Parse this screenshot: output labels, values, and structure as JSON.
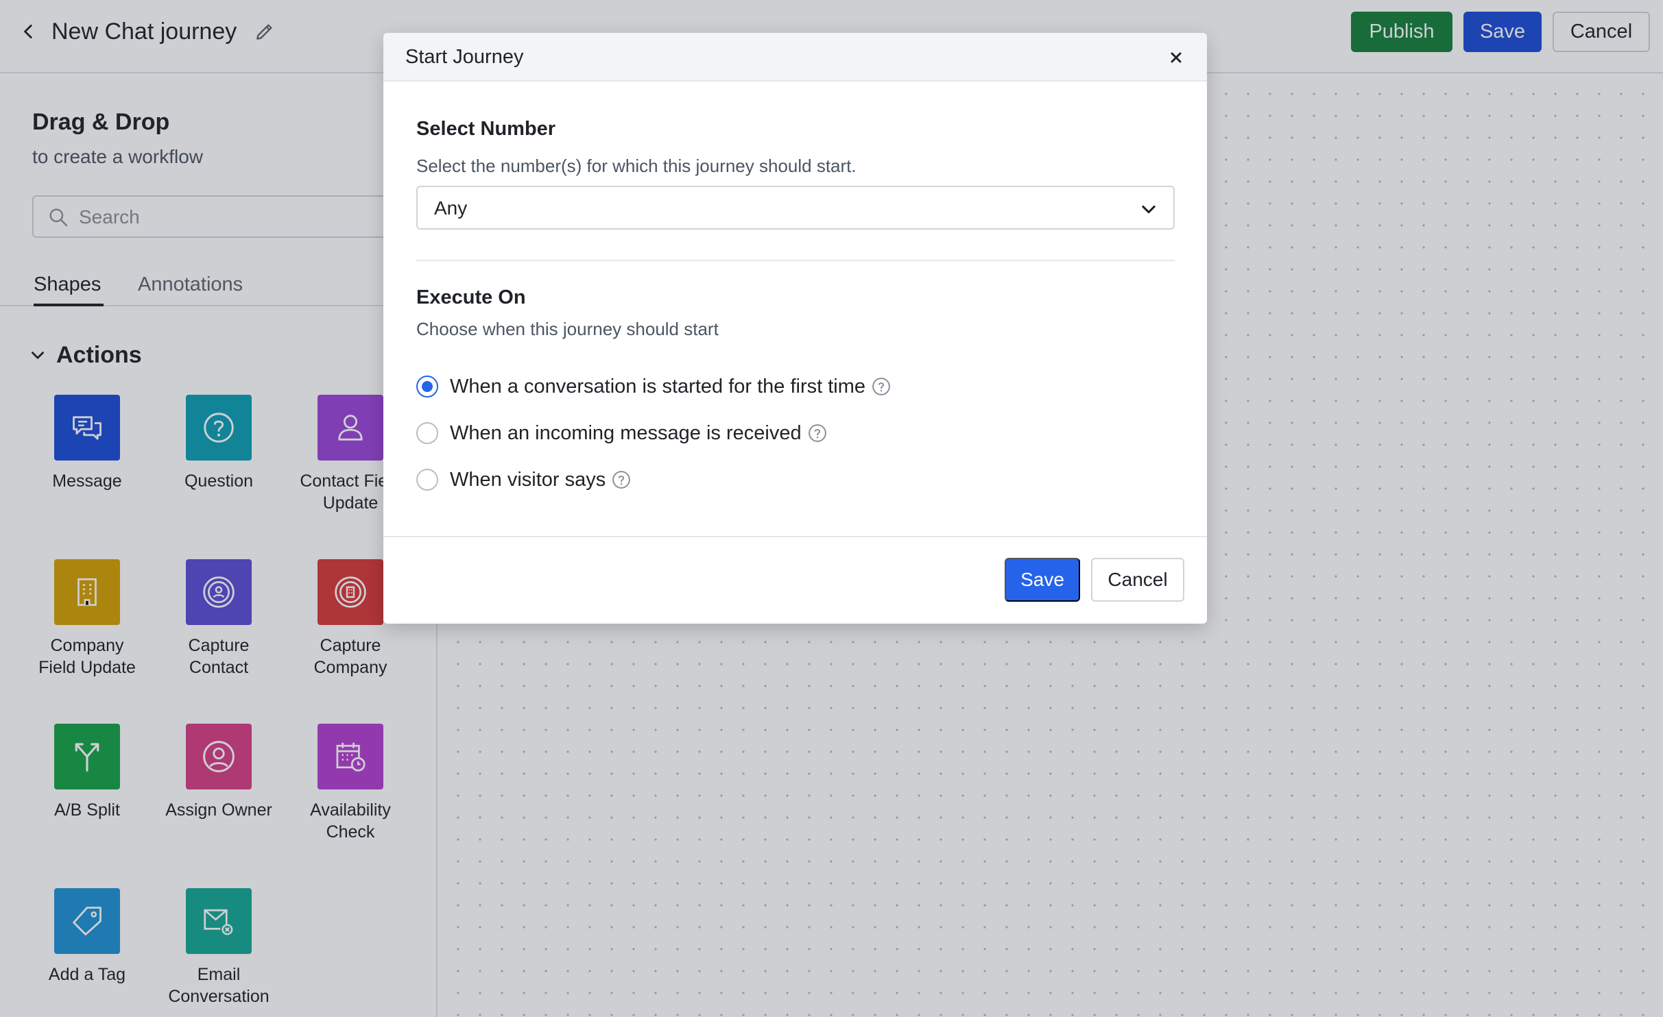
{
  "header": {
    "title": "New Chat journey",
    "publish_label": "Publish",
    "save_label": "Save",
    "cancel_label": "Cancel",
    "colors": {
      "publish": "#15803d",
      "save": "#1d4ed8"
    }
  },
  "sidebar": {
    "title": "Drag & Drop",
    "subtitle": "to create a workflow",
    "search_placeholder": "Search",
    "tabs": [
      {
        "label": "Shapes",
        "active": true
      },
      {
        "label": "Annotations",
        "active": false
      }
    ],
    "section_title": "Actions",
    "shapes": [
      {
        "label": "Message",
        "icon": "chat-bubbles-icon",
        "color": "#1d4ed8"
      },
      {
        "label": "Question",
        "icon": "question-circle-icon",
        "color": "#0e9fb5"
      },
      {
        "label": "Contact Field\nUpdate",
        "icon": "person-icon",
        "color": "#9b46d9"
      },
      {
        "label": "Company\nField Update",
        "icon": "building-icon",
        "color": "#d4a106"
      },
      {
        "label": "Capture\nContact",
        "icon": "capture-contact-icon",
        "color": "#5b4fd6"
      },
      {
        "label": "Capture\nCompany",
        "icon": "capture-company-icon",
        "color": "#d63a3a"
      },
      {
        "label": "A/B Split",
        "icon": "split-arrow-icon",
        "color": "#16a34a"
      },
      {
        "label": "Assign Owner",
        "icon": "owner-icon",
        "color": "#d63f86"
      },
      {
        "label": "Availability\nCheck",
        "icon": "calendar-clock-icon",
        "color": "#b43fd1"
      },
      {
        "label": "Add a Tag",
        "icon": "tag-icon",
        "color": "#1f93d6"
      },
      {
        "label": "Email\nConversation",
        "icon": "email-icon",
        "color": "#16a896"
      }
    ]
  },
  "modal": {
    "title": "Start Journey",
    "select_number": {
      "label": "Select Number",
      "help": "Select the number(s) for which this journey should start.",
      "value": "Any"
    },
    "execute_on": {
      "label": "Execute On",
      "help": "Choose when this journey should start",
      "options": [
        {
          "label": "When a conversation is started for the first time",
          "checked": true
        },
        {
          "label": "When an incoming message is received",
          "checked": false
        },
        {
          "label": "When visitor says",
          "checked": false
        }
      ]
    },
    "save_label": "Save",
    "cancel_label": "Cancel"
  }
}
